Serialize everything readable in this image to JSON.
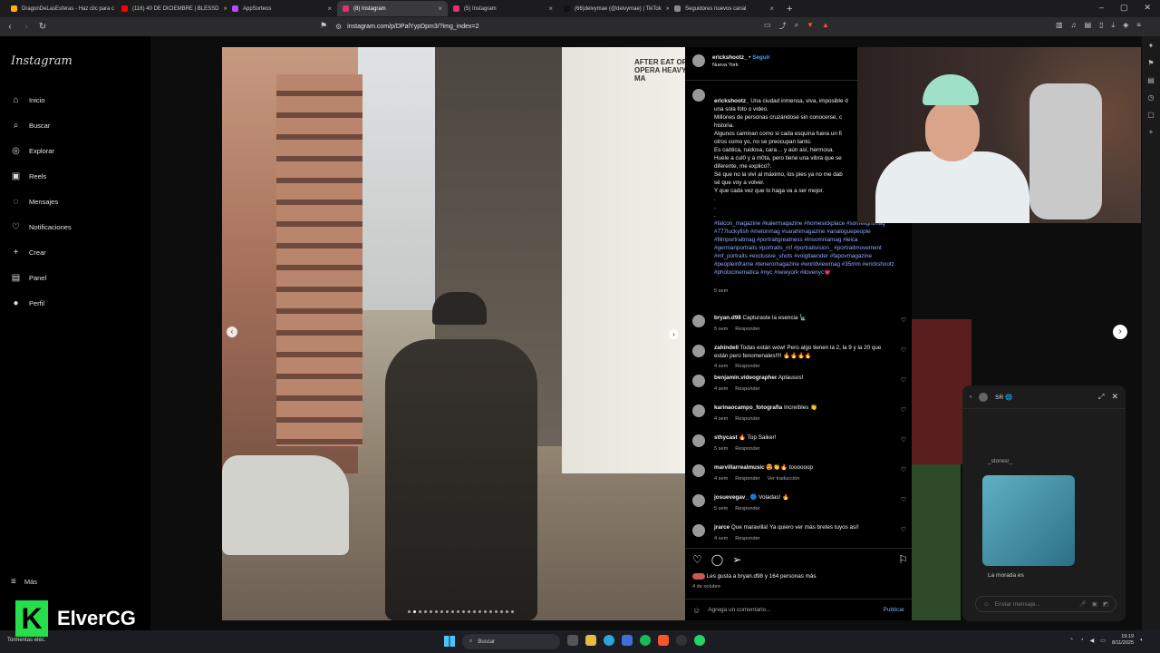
{
  "browser": {
    "tabs": [
      {
        "label": "DragonDeLasEsferas - Haz clic para c",
        "color": "#ffb300"
      },
      {
        "label": "(116) 40 DE DICIEMBRE | BLESSD",
        "color": "#ff0000"
      },
      {
        "label": "AppSorteos",
        "color": "#b04dff"
      },
      {
        "label": "(8) Instagram",
        "color": "#e1306c"
      },
      {
        "label": "(5) Instagram",
        "color": "#e1306c"
      },
      {
        "label": "(66)deivymae (@deivymae) | TikTok",
        "color": "#111111"
      },
      {
        "label": "Seguidores nuevos canal",
        "color": "#888888"
      }
    ],
    "url": "instagram.com/p/DPalYypDpm3/?img_index=2"
  },
  "sidebar": {
    "logo": "Instagram",
    "items": [
      {
        "label": "Inicio",
        "icon": "home-icon",
        "glyph": "⌂"
      },
      {
        "label": "Buscar",
        "icon": "search-icon",
        "glyph": "⌕"
      },
      {
        "label": "Explorar",
        "icon": "compass-icon",
        "glyph": "◎"
      },
      {
        "label": "Reels",
        "icon": "reels-icon",
        "glyph": "▣"
      },
      {
        "label": "Mensajes",
        "icon": "messenger-icon",
        "glyph": "◌"
      },
      {
        "label": "Notificaciones",
        "icon": "heart-icon",
        "glyph": "♡"
      },
      {
        "label": "Crear",
        "icon": "plus-icon",
        "glyph": "+"
      },
      {
        "label": "Panel",
        "icon": "dashboard-icon",
        "glyph": "▤"
      },
      {
        "label": "Perfil",
        "icon": "avatar-icon",
        "glyph": "●"
      }
    ],
    "more": "Más"
  },
  "post": {
    "author": "erickshootz_",
    "follow": "Seguir",
    "location": "Nueva York",
    "caption": "Una ciudad inmensa, viva, imposible d\nuna sola foto o video.\nMillones de personas cruzándose sin conocerse, c\nhistoria.\nAlgunos caminan como si cada esquina fuera un fi\notros como yo, no se preocupan tanto.\nEs caótica, ruidosa, cara… y aún así, hermosa.\nHuele a cul0 y a m0ta, pero tiene una vibra que se\ndiferente, me explico?.\nSé que no la viví al máximo, los pies ya no me dab\nsé que voy a volver.\nY que cada vez que lo haga va a ser mejor.\n.\n.\n.",
    "hashtags": "#falcon_magazine #kalermagazine #homesickplace #somelightmag #777luckyfish #melonmag #sarahimagazine #analoguepeople #filmportraitmag #portraitgreatness #insomniamag #leica #germanportraits #portraits_mf #portraitvision_ #portraitmovement #mf_portraits #exclusive_shots #voigtlaender #fapovmagazine #peopleinframe #teneromagazine #worldviewmag #35mm #erickshootz #photocinematica #nyc #newyork #ilovenyc💗",
    "caption_time": "5 sem",
    "image_sign": "AFTER EAT OR OPERA HEAVY MA",
    "likes": "Les gusta a bryan.d98 y 164 personas más",
    "date": "4 de octubre",
    "add_comment": "Agrega un comentario...",
    "publish": "Publicar"
  },
  "comments": [
    {
      "user": "bryan.d98",
      "text": "Capturaste la esencia 🗽",
      "time": "5 sem",
      "reply": "Responder",
      "extra": ""
    },
    {
      "user": "zahindell",
      "text": "Todas están wow! Pero algo tienen la 2, la 9 y la 20 que están pero fenomenales!!!! 🔥🔥🔥🔥",
      "time": "4 sem",
      "reply": "Responder",
      "extra": ""
    },
    {
      "user": "benjamin.videographer",
      "text": "Aplausos!",
      "time": "4 sem",
      "reply": "Responder",
      "extra": ""
    },
    {
      "user": "karinaocampo_fotografia",
      "text": "Increíbles 👏",
      "time": "4 sem",
      "reply": "Responder",
      "extra": ""
    },
    {
      "user": "sthycast",
      "text": "🔥 Top Saiker!",
      "time": "5 sem",
      "reply": "Responder",
      "extra": ""
    },
    {
      "user": "marvillarrealmusic",
      "text": "😍👏🔥 toooooop",
      "time": "4 sem",
      "reply": "Responder",
      "extra": "Ver traducción"
    },
    {
      "user": "josuevegav_",
      "text": "🔵 Voladas! 🔥",
      "time": "5 sem",
      "reply": "Responder",
      "extra": ""
    },
    {
      "user": "jrarce",
      "text": "Que maravilla! Ya quiero ver más bretes tuyos así!",
      "time": "4 sem",
      "reply": "Responder",
      "extra": ""
    }
  ],
  "dm": {
    "title": "SR 🌐",
    "stored": "_storesr_",
    "message": "La morada es",
    "input": "Enviar mensaje..."
  },
  "taskbar": {
    "weather": "Tormentas eléc.",
    "search": "Buscar",
    "time": "19:19",
    "date": "8/11/2025"
  },
  "watermark": {
    "letter": "K",
    "name": "ElverCG"
  }
}
